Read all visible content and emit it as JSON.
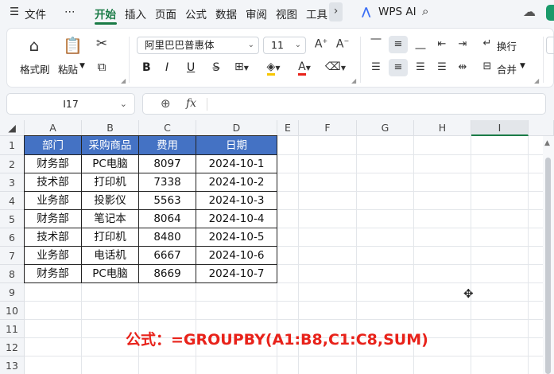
{
  "menubar": {
    "menu_icon": "☰",
    "file": "文件",
    "more": "⋯",
    "tabs": [
      "开始",
      "插入",
      "页面",
      "公式",
      "数据",
      "审阅",
      "视图",
      "工具"
    ],
    "wps_ai": "WPS AI"
  },
  "ribbon": {
    "format_painter": "格式刷",
    "paste": "粘贴",
    "font_name": "阿里巴巴普惠体",
    "font_size": "11",
    "bold": "B",
    "italic": "I",
    "underline": "U",
    "wrap": "换行",
    "merge": "合并"
  },
  "formula_bar": {
    "cell_ref": "I17",
    "fx": "fx",
    "content": ""
  },
  "grid": {
    "columns": [
      "A",
      "B",
      "C",
      "D",
      "E",
      "F",
      "G",
      "H",
      "I"
    ],
    "rows": [
      "1",
      "2",
      "3",
      "4",
      "5",
      "6",
      "7",
      "8",
      "9",
      "10",
      "11",
      "12",
      "13"
    ],
    "header": [
      "部门",
      "采购商品",
      "费用",
      "日期"
    ],
    "data": [
      [
        "财务部",
        "PC电脑",
        "8097",
        "2024-10-1"
      ],
      [
        "技术部",
        "打印机",
        "7338",
        "2024-10-2"
      ],
      [
        "业务部",
        "投影仪",
        "5563",
        "2024-10-3"
      ],
      [
        "财务部",
        "笔记本",
        "8064",
        "2024-10-4"
      ],
      [
        "技术部",
        "打印机",
        "8480",
        "2024-10-5"
      ],
      [
        "业务部",
        "电话机",
        "6667",
        "2024-10-6"
      ],
      [
        "财务部",
        "PC电脑",
        "8669",
        "2024-10-7"
      ]
    ]
  },
  "annotation": "公式：=GROUPBY(A1:B8,C1:C8,SUM)",
  "colors": {
    "accent": "#1a7b46",
    "header_fill": "#4472c4",
    "annotation": "#e8221a"
  }
}
